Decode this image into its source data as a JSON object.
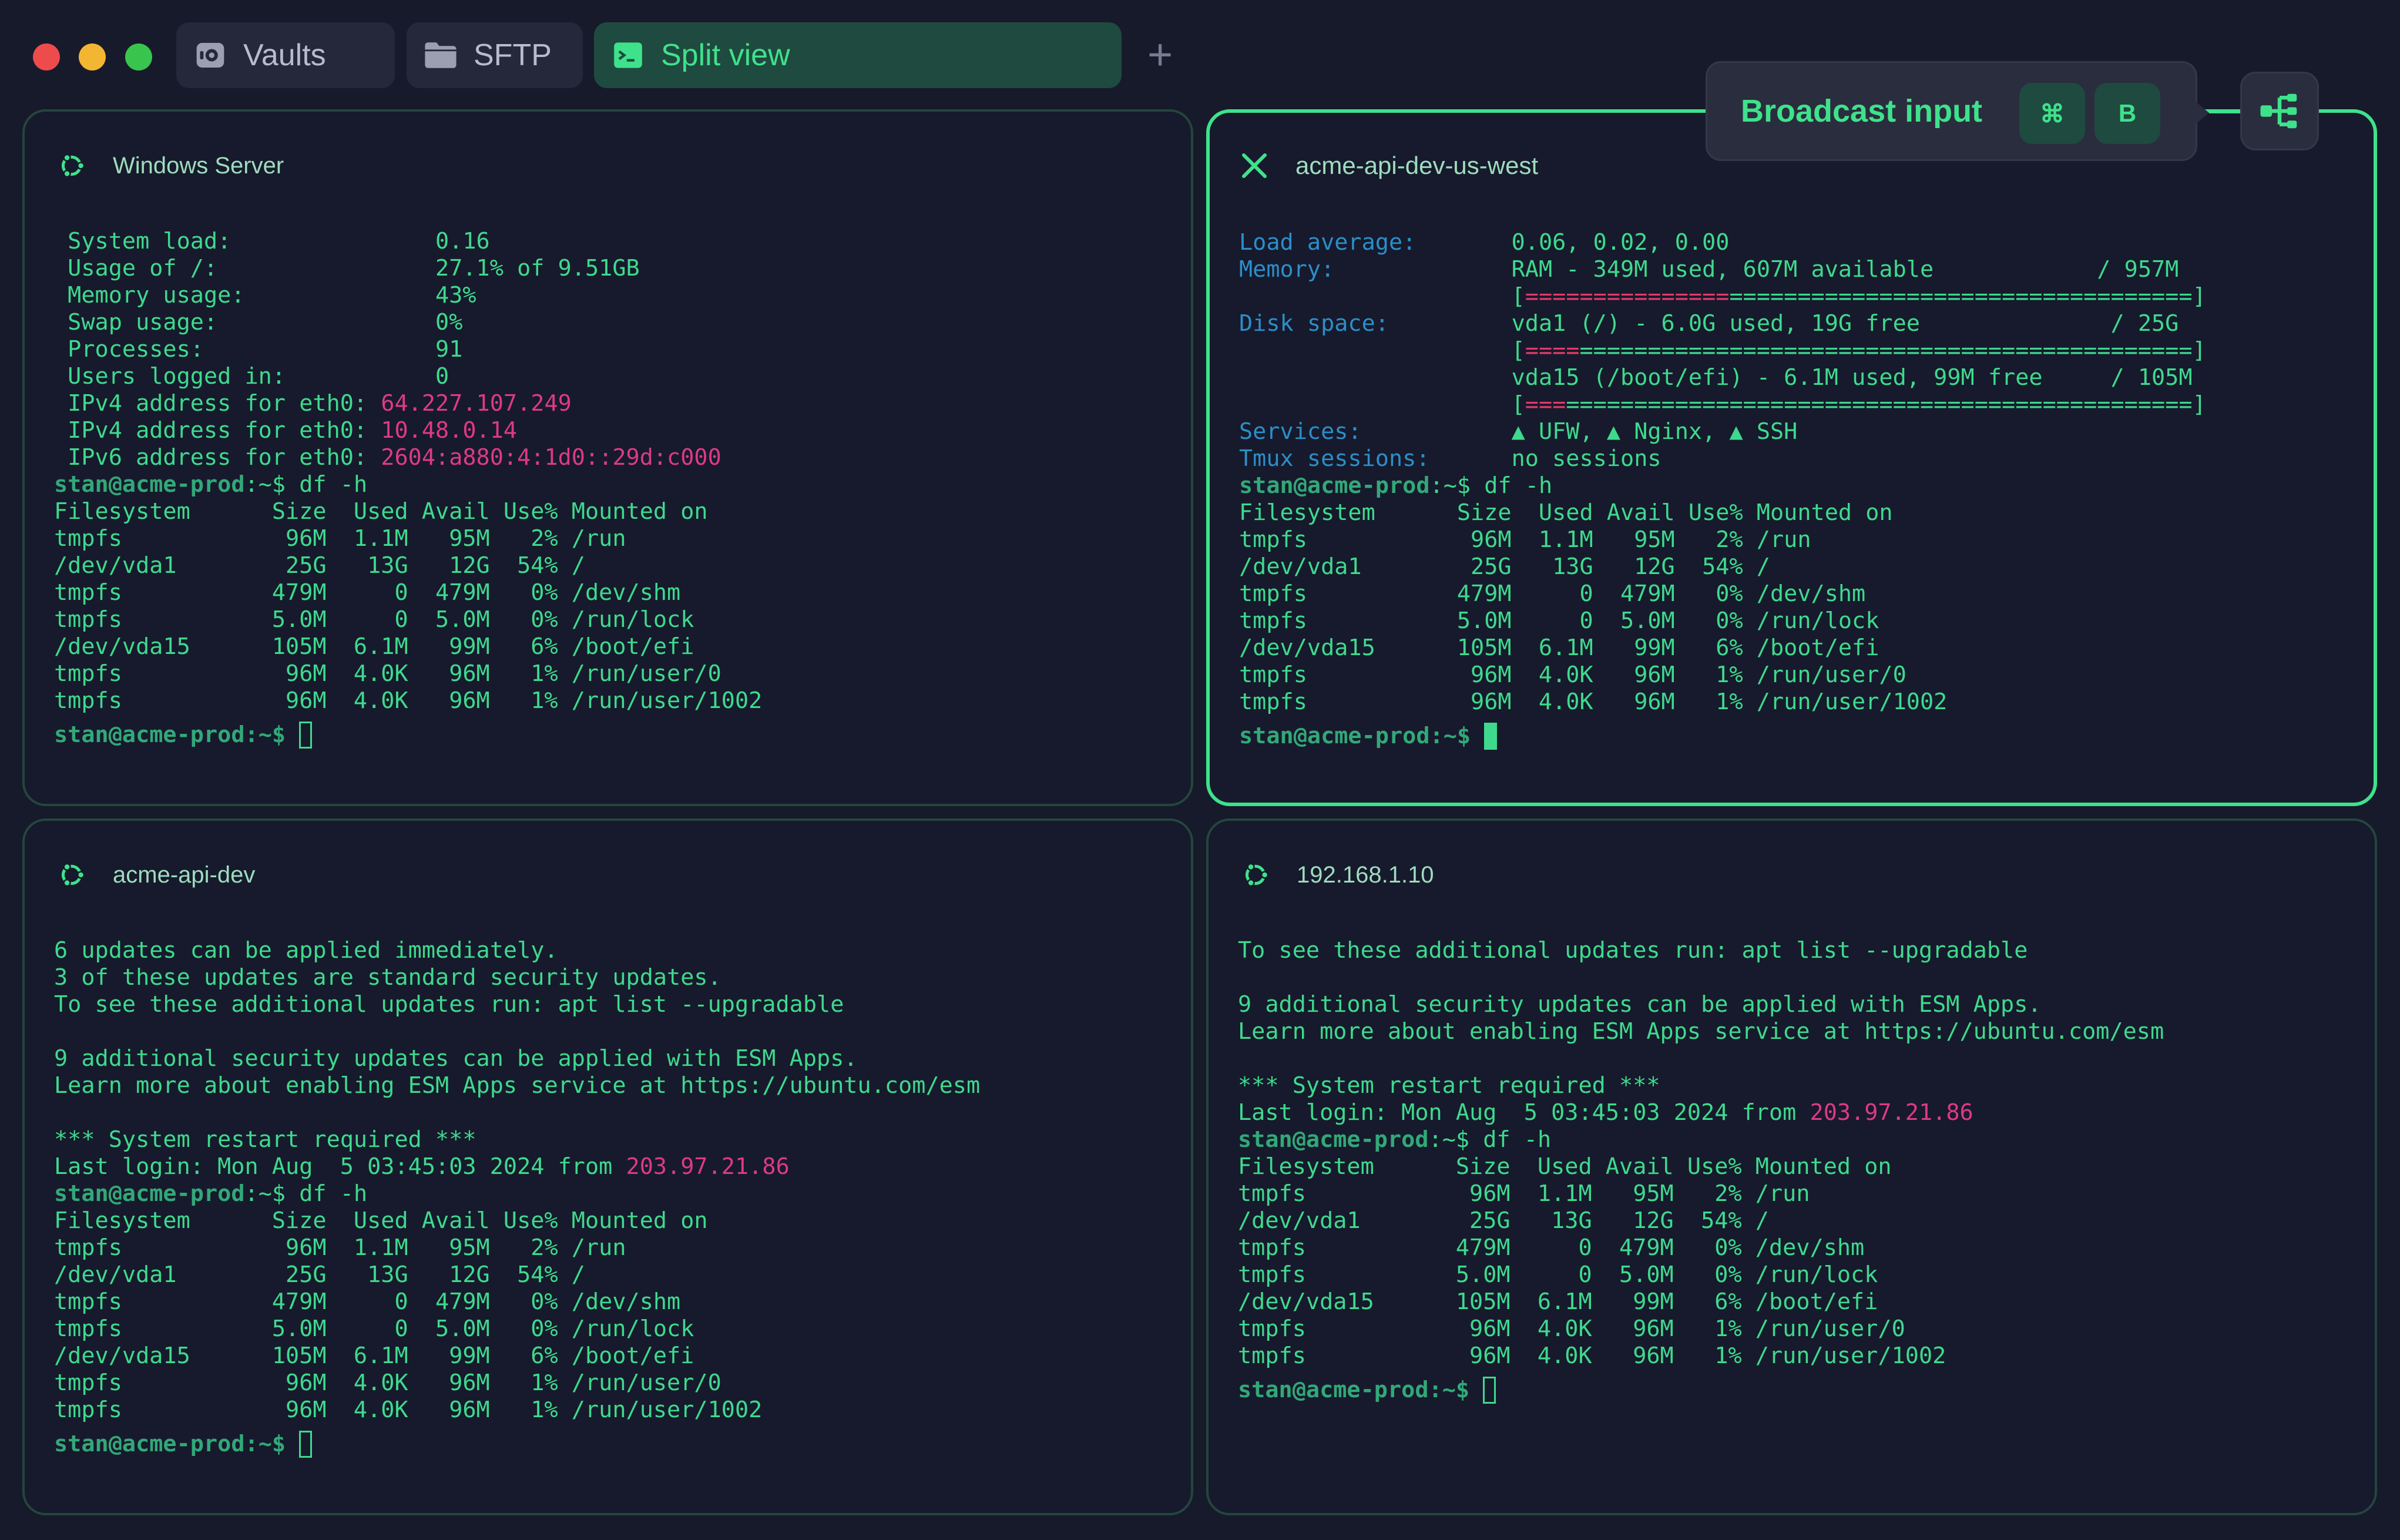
{
  "window": {
    "tabs": [
      {
        "label": "Vaults",
        "icon": "vault-icon"
      },
      {
        "label": "SFTP",
        "icon": "folder-icon"
      },
      {
        "label": "Split view",
        "icon": "terminal-icon",
        "active": true
      }
    ],
    "new_tab": "+"
  },
  "broadcast": {
    "label": "Broadcast input",
    "key1": "⌘",
    "key2": "B"
  },
  "panes": [
    {
      "title": "Windows Server",
      "lines": [
        {
          "t": " System load:               0.16"
        },
        {
          "t": " Usage of /:                27.1% of 9.51GB"
        },
        {
          "t": " Memory usage:              43%"
        },
        {
          "t": " Swap usage:                0%"
        },
        {
          "t": " Processes:                 91"
        },
        {
          "t": " Users logged in:           0"
        },
        {
          "t": " IPv4 address for eth0: ",
          "ip": "64.227.107.249"
        },
        {
          "t": " IPv4 address for eth0: ",
          "ip": "10.48.0.14"
        },
        {
          "t": " IPv6 address for eth0: ",
          "ip": "2604:a880:4:1d0::29d:c000"
        },
        {
          "p": "stan@acme-prod",
          "t": ":~$ df -h"
        },
        {
          "t": "Filesystem      Size  Used Avail Use% Mounted on"
        },
        {
          "t": "tmpfs            96M  1.1M   95M   2% /run"
        },
        {
          "t": "/dev/vda1        25G   13G   12G  54% /"
        },
        {
          "t": "tmpfs           479M     0  479M   0% /dev/shm"
        },
        {
          "t": "tmpfs           5.0M     0  5.0M   0% /run/lock"
        },
        {
          "t": "/dev/vda15      105M  6.1M   99M   6% /boot/efi"
        },
        {
          "t": "tmpfs            96M  4.0K   96M   1% /run/user/0"
        },
        {
          "t": "tmpfs            96M  4.0K   96M   1% /run/user/1002"
        }
      ],
      "final_prompt": {
        "user": "stan@acme-prod",
        "rest": ":~$ "
      }
    },
    {
      "title": "acme-api-dev-us-west",
      "lines": [
        {
          "l": "Load average:       ",
          "t": "0.06, 0.02, 0.00"
        },
        {
          "l": "Memory:             ",
          "t": "RAM - 349M used, 607M available            / 957M"
        },
        {
          "l": "                    ",
          "t": "[",
          "r": "===============",
          "g": "==================================",
          "e": "]"
        },
        {
          "l": "Disk space:         ",
          "t": "vda1 (/) - 6.0G used, 19G free              / 25G"
        },
        {
          "l": "                    ",
          "t": "[",
          "r": "====",
          "g": "=============================================",
          "e": "]"
        },
        {
          "l": "                    ",
          "t": "vda15 (/boot/efi) - 6.1M used, 99M free     / 105M"
        },
        {
          "l": "                    ",
          "t": "[",
          "r": "===",
          "g": "==============================================",
          "e": "]"
        },
        {
          "l": "Services:           ",
          "t": "▲ UFW, ▲ Nginx, ▲ SSH"
        },
        {
          "l": "Tmux sessions:      ",
          "t": "no sessions"
        },
        {
          "p": "stan@acme-prod",
          "t": ":~$ df -h"
        },
        {
          "t": "Filesystem      Size  Used Avail Use% Mounted on"
        },
        {
          "t": "tmpfs            96M  1.1M   95M   2% /run"
        },
        {
          "t": "/dev/vda1        25G   13G   12G  54% /"
        },
        {
          "t": "tmpfs           479M     0  479M   0% /dev/shm"
        },
        {
          "t": "tmpfs           5.0M     0  5.0M   0% /run/lock"
        },
        {
          "t": "/dev/vda15      105M  6.1M   99M   6% /boot/efi"
        },
        {
          "t": "tmpfs            96M  4.0K   96M   1% /run/user/0"
        },
        {
          "t": "tmpfs            96M  4.0K   96M   1% /run/user/1002"
        }
      ],
      "final_prompt": {
        "user": "stan@acme-prod",
        "rest": ":~$ "
      }
    },
    {
      "title": "acme-api-dev",
      "lines": [
        {
          "t": "6 updates can be applied immediately."
        },
        {
          "t": "3 of these updates are standard security updates."
        },
        {
          "t": "To see these additional updates run: apt list --upgradable"
        },
        {
          "t": ""
        },
        {
          "t": "9 additional security updates can be applied with ESM Apps."
        },
        {
          "t": "Learn more about enabling ESM Apps service at https://ubuntu.com/esm"
        },
        {
          "t": ""
        },
        {
          "t": "*** System restart required ***"
        },
        {
          "t": "Last login: Mon Aug  5 03:45:03 2024 from ",
          "ip": "203.97.21.86"
        },
        {
          "p": "stan@acme-prod",
          "t": ":~$ df -h"
        },
        {
          "t": "Filesystem      Size  Used Avail Use% Mounted on"
        },
        {
          "t": "tmpfs            96M  1.1M   95M   2% /run"
        },
        {
          "t": "/dev/vda1        25G   13G   12G  54% /"
        },
        {
          "t": "tmpfs           479M     0  479M   0% /dev/shm"
        },
        {
          "t": "tmpfs           5.0M     0  5.0M   0% /run/lock"
        },
        {
          "t": "/dev/vda15      105M  6.1M   99M   6% /boot/efi"
        },
        {
          "t": "tmpfs            96M  4.0K   96M   1% /run/user/0"
        },
        {
          "t": "tmpfs            96M  4.0K   96M   1% /run/user/1002"
        }
      ],
      "final_prompt": {
        "user": "stan@acme-prod",
        "rest": ":~$ "
      }
    },
    {
      "title": "192.168.1.10",
      "lines": [
        {
          "t": "To see these additional updates run: apt list --upgradable"
        },
        {
          "t": ""
        },
        {
          "t": "9 additional security updates can be applied with ESM Apps."
        },
        {
          "t": "Learn more about enabling ESM Apps service at https://ubuntu.com/esm"
        },
        {
          "t": ""
        },
        {
          "t": "*** System restart required ***"
        },
        {
          "t": "Last login: Mon Aug  5 03:45:03 2024 from ",
          "ip": "203.97.21.86"
        },
        {
          "p": "stan@acme-prod",
          "t": ":~$ df -h"
        },
        {
          "t": "Filesystem      Size  Used Avail Use% Mounted on"
        },
        {
          "t": "tmpfs            96M  1.1M   95M   2% /run"
        },
        {
          "t": "/dev/vda1        25G   13G   12G  54% /"
        },
        {
          "t": "tmpfs           479M     0  479M   0% /dev/shm"
        },
        {
          "t": "tmpfs           5.0M     0  5.0M   0% /run/lock"
        },
        {
          "t": "/dev/vda15      105M  6.1M   99M   6% /boot/efi"
        },
        {
          "t": "tmpfs            96M  4.0K   96M   1% /run/user/0"
        },
        {
          "t": "tmpfs            96M  4.0K   96M   1% /run/user/1002"
        }
      ],
      "final_prompt": {
        "user": "stan@acme-prod",
        "rest": ":~$ "
      }
    }
  ],
  "colors": {
    "accent": "#3ee28b",
    "background": "#171a2b",
    "ip_highlight": "#dd3a82",
    "label_blue": "#2c8ec8",
    "traffic_close": "#ee4b4d",
    "traffic_min": "#f3b632",
    "traffic_max": "#38c54d"
  }
}
